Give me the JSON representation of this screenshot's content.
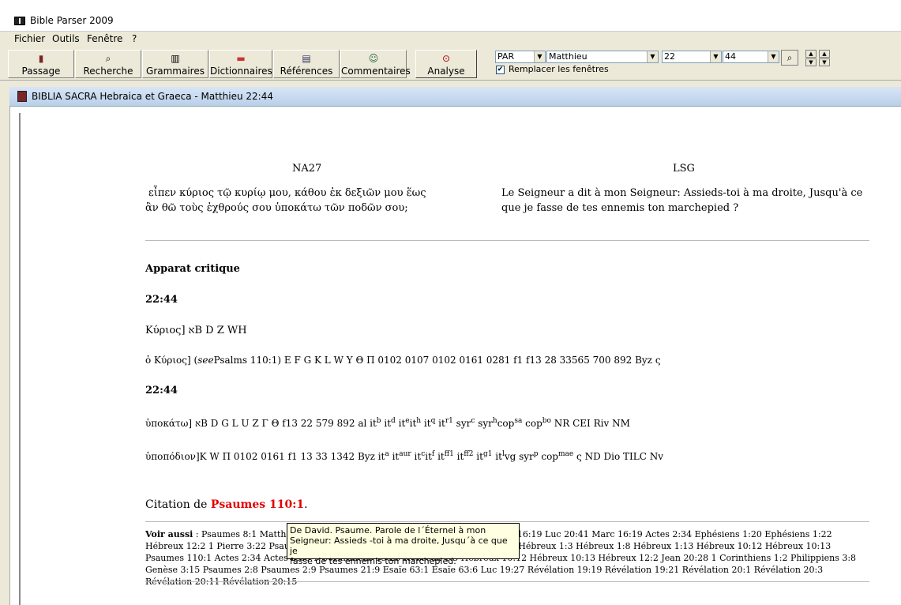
{
  "window": {
    "title": "Bible Parser 2009"
  },
  "menu": [
    "Fichier",
    "Outils",
    "Fenêtre",
    "?"
  ],
  "toolbar": {
    "buttons": [
      {
        "label": "Passage",
        "icon": "book-icon"
      },
      {
        "label": "Recherche",
        "icon": "search-icon"
      },
      {
        "label": "Grammaires",
        "icon": "books-icon"
      },
      {
        "label": "Dictionnaires",
        "icon": "dictionary-icon"
      },
      {
        "label": "Références",
        "icon": "references-icon"
      },
      {
        "label": "Commentaires",
        "icon": "commentator-icon"
      },
      {
        "label": "Analyse",
        "icon": "magnifier-icon"
      }
    ],
    "version_select": "PAR",
    "book_select": "Matthieu",
    "chapter_select": "22",
    "verse_select": "44",
    "checkbox_label": "Remplacer les fenêtres",
    "checkbox_checked": true
  },
  "child_window": {
    "title": "BIBLIA SACRA Hebraica et Graeca - Matthieu 22:44"
  },
  "columns": {
    "left_head": "NA27",
    "right_head": "LSG",
    "left_line1": "εἶπεν κύριος τῷ κυρίῳ μου, κάθου ἐκ δεξιῶν μου ἕως",
    "left_line2": "ἂν θῶ τοὺς ἐχθρούς σου ὑποκάτω τῶν ποδῶν σου;",
    "right_line1": "Le Seigneur a dit à mon Seigneur: Assieds-toi à ma droite, Jusqu'à ce",
    "right_line2": "que je fasse de tes ennemis ton marchepied ?"
  },
  "apparatus": {
    "title": "Apparat critique",
    "ref1": "22:44",
    "line1": "Κύριος] אB D Z WH",
    "line2_a": "ὁ Κύριος] (",
    "line2_see": "see",
    "line2_b": "Psalms 110:1) E F G K L W Y Θ Π 0102 0107 0102 0161 0281 f1 f13 28 33565 700 892 Byz ς",
    "ref2": "22:44",
    "line3_parts": [
      "ὑποκάτω] אB D G L U Z Γ Θ f13 22 579 892 al it",
      "b",
      " it",
      "d",
      " it",
      "e",
      "it",
      "h",
      " it",
      "q",
      " it",
      "r1",
      " syr",
      "c",
      " syr",
      "h",
      "cop",
      "sa",
      " cop",
      "bo",
      " NR CEI Riv NM"
    ],
    "line4_parts": [
      "ὑποπόδιον]K W Π 0102 0161 f1 13 33 1342 Byz it",
      "a",
      " it",
      "aur",
      " it",
      "c",
      "it",
      "f",
      " it",
      "ff1",
      " it",
      "ff2",
      " it",
      "g1",
      " it",
      "l",
      "vg syr",
      "p",
      " cop",
      "mae",
      " ς ND Dio TILC Nv"
    ]
  },
  "citation": {
    "prefix": "Citation de ",
    "ref": "Psaumes 110:1",
    "suffix": "."
  },
  "voir_aussi": {
    "label": "Voir aussi",
    "text": " : Psaumes 8:1 Matthieu 22:41 Marc 12:35 Marc 12:36 Marc 14:62 Marc 16:19 Luc 20:41 Marc 16:19 Actes 2:34 Ephésiens 1:20 Ephésiens 1:22 Hébreux 12:2 1 Pierre 3:22 Psaumes 2:6 Psaumes 2:9 Psaumes 45:6 Psaumes 110:2 Hébreux 1:3 Hébreux 1:8 Hébreux 1:13 Hébreux 10:12 Hébreux 10:13 Psaumes 110:1 Actes 2:34 Actes 2:35 1 Corinthiens 15:25 Hébreux 1:3 Hébreux 10:12 Hébreux 10:13 Hébreux 12:2 Jean 20:28 1 Corinthiens 1:2 Philippiens 3:8 Genèse 3:15 Psaumes 2:8 Psaumes 2:9 Psaumes 21:9 Esaïe 63:1 Esaïe 63:6 Luc 19:27 Révélation 19:19 Révélation 19:21 Révélation 20:1 Révélation 20:3 Révélation 20:11 Révélation 20:15"
  },
  "tooltip": {
    "line1": "De David. Psaume. Parole de l´Éternel à mon",
    "line2": "Seigneur: Assieds -toi à ma droite, Jusqu´à ce que je",
    "line3": "fasse de tes ennemis ton marchepied."
  }
}
